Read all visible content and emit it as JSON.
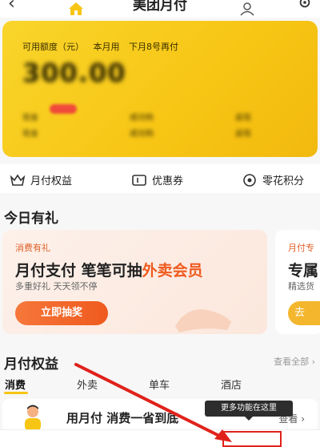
{
  "header": {
    "title": "美团月付",
    "back_icon": "arrow-left-icon",
    "settings_icon": "gear-icon"
  },
  "card": {
    "credit_label": "可用额度（元）",
    "billing_this_month": "本月用",
    "billing_next_month": "下月8号再付",
    "amount": "300.00",
    "blurred_row1": [
      "现金",
      "成功购",
      "返现"
    ],
    "blurred_row2": [
      "现金",
      "成功购",
      "返现"
    ],
    "background_color": "#f7c514"
  },
  "quick_links": [
    {
      "label": "月付权益",
      "icon": "crown-icon"
    },
    {
      "label": "优惠券",
      "icon": "coupon-icon"
    },
    {
      "label": "零花积分",
      "icon": "coin-icon"
    }
  ],
  "today_gifts": {
    "title": "今日有礼"
  },
  "promo": {
    "tag": "消费有礼",
    "headline_prefix": "月付支付 笔笔可抽",
    "headline_highlight": "外卖会员",
    "subtitle": "多重好礼 天天领不停",
    "button": "立即抽奖",
    "accent_color": "#ef5a1e"
  },
  "promo2": {
    "tag": "月付专",
    "headline": "专属",
    "subtitle": "精选货",
    "button": "去"
  },
  "benefits": {
    "title": "月付权益",
    "view_all": "查看全部 ›",
    "tabs": [
      "消费",
      "外卖",
      "单车",
      "酒店"
    ],
    "active_tab": "消费",
    "row_text": "用月付 消费一省到底",
    "row_more": "查看 ›"
  },
  "tooltip": {
    "text": "更多功能在这里"
  },
  "bottom_nav": {
    "home_icon": "home-icon",
    "mine_icon": "user-icon"
  },
  "annotation": {
    "color": "#e0221b"
  }
}
